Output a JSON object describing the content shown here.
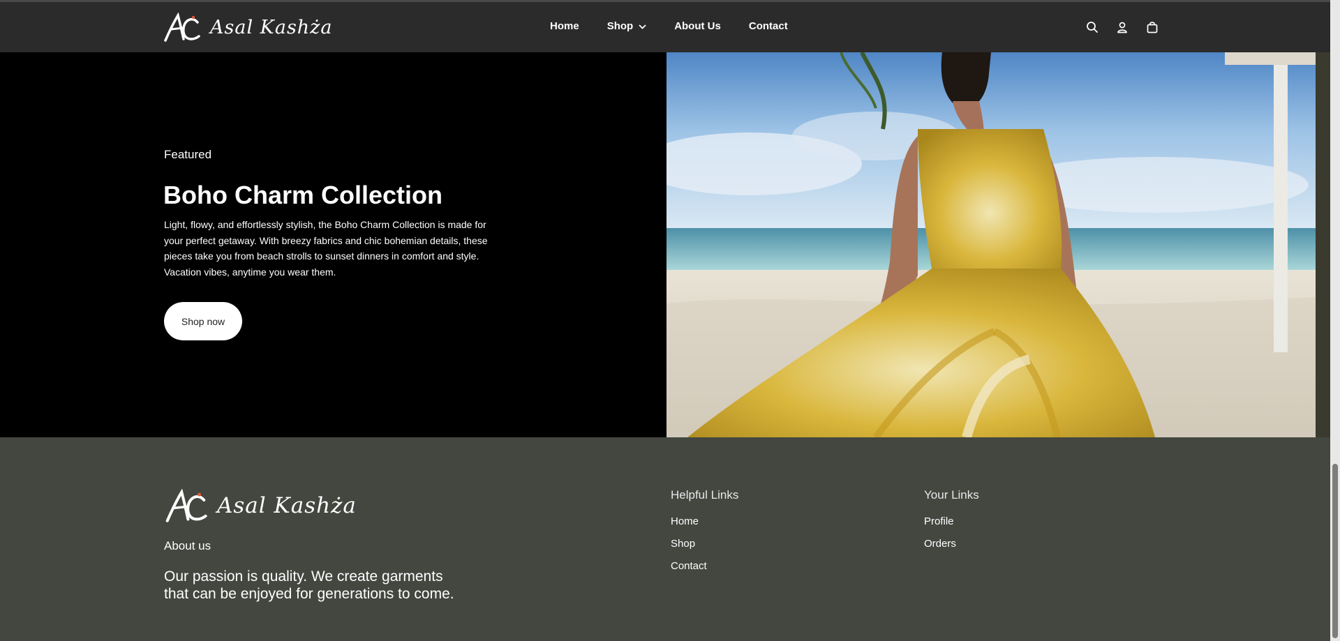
{
  "header": {
    "brand": "Asal Kashża",
    "nav": [
      {
        "label": "Home"
      },
      {
        "label": "Shop",
        "has_dropdown": true
      },
      {
        "label": "About Us"
      },
      {
        "label": "Contact"
      }
    ],
    "icons": [
      "search-icon",
      "account-icon",
      "shopping-bag-icon"
    ]
  },
  "hero": {
    "eyebrow": "Featured",
    "title": "Boho Charm Collection",
    "description": "Light, flowy, and effortlessly stylish, the Boho Charm Collection is made for your perfect getaway. With breezy fabrics and chic bohemian details, these pieces take you from beach strolls to sunset dinners in comfort and style. Vacation vibes, anytime you wear them.",
    "button_label": "Shop now",
    "image_subject": "woman in yellow baroque-print sundress on a tropical beach"
  },
  "footer": {
    "brand": "Asal Kashża",
    "about_label": "About us",
    "tagline": "Our passion is quality. We create garments that can be enjoyed for generations to come.",
    "helpful_links": {
      "title": "Helpful Links",
      "items": [
        "Home",
        "Shop",
        "Contact"
      ]
    },
    "your_links": {
      "title": "Your Links",
      "items": [
        "Profile",
        "Orders"
      ]
    }
  },
  "colors": {
    "header_bg": "#2b2b2b",
    "hero_bg": "#000000",
    "footer_bg": "#434740",
    "button_bg": "#ffffff"
  }
}
